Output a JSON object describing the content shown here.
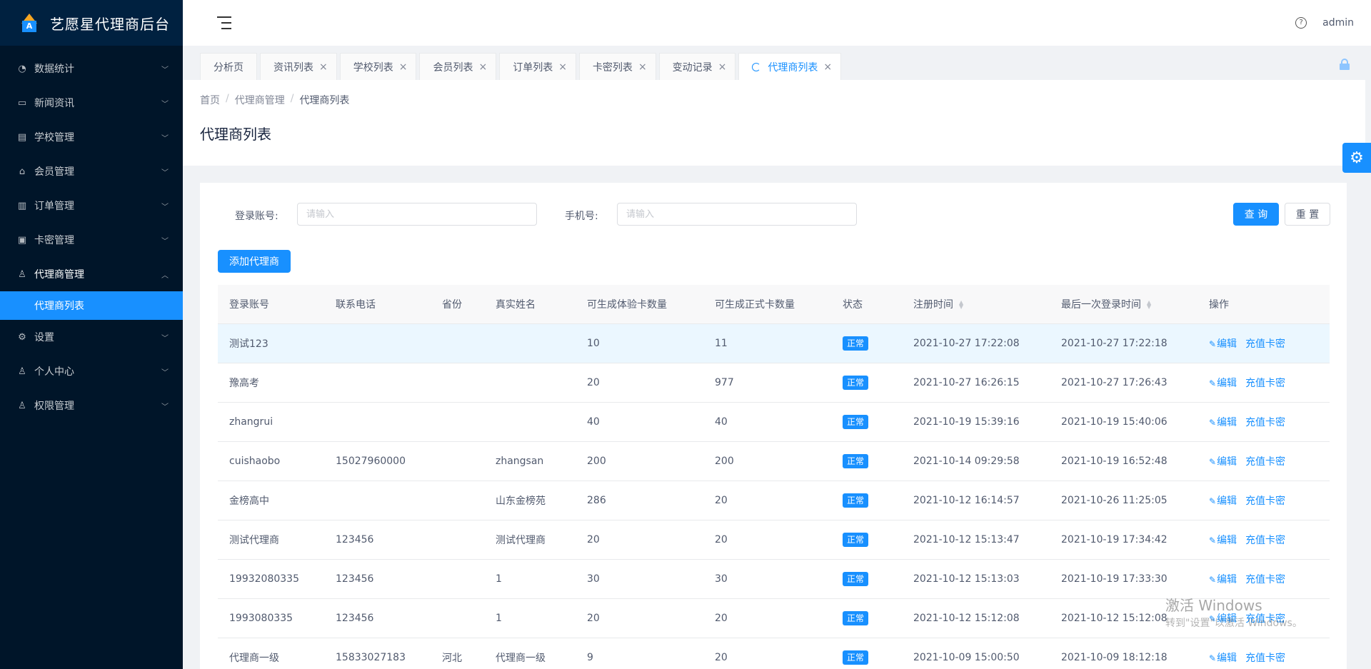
{
  "app": {
    "title": "艺愿星代理商后台",
    "logo_letter": "A"
  },
  "sidebar": {
    "items": [
      {
        "label": "数据统计",
        "icon": "dashboard-icon",
        "glyph": "◔"
      },
      {
        "label": "新闻资讯",
        "icon": "news-icon",
        "glyph": "▭"
      },
      {
        "label": "学校管理",
        "icon": "school-icon",
        "glyph": "▤"
      },
      {
        "label": "会员管理",
        "icon": "member-icon",
        "glyph": "⌂"
      },
      {
        "label": "订单管理",
        "icon": "order-icon",
        "glyph": "▥"
      },
      {
        "label": "卡密管理",
        "icon": "card-icon",
        "glyph": "▣"
      },
      {
        "label": "代理商管理",
        "icon": "agent-icon",
        "glyph": "♙"
      },
      {
        "label": "设置",
        "icon": "settings-icon",
        "glyph": "⚙"
      },
      {
        "label": "个人中心",
        "icon": "user-icon",
        "glyph": "♙"
      },
      {
        "label": "权限管理",
        "icon": "permission-icon",
        "glyph": "♙"
      }
    ],
    "active_sub": "代理商列表"
  },
  "header": {
    "user": "admin",
    "help_glyph": "?"
  },
  "tabs": [
    {
      "label": "分析页",
      "closable": false
    },
    {
      "label": "资讯列表",
      "closable": true
    },
    {
      "label": "学校列表",
      "closable": true
    },
    {
      "label": "会员列表",
      "closable": true
    },
    {
      "label": "订单列表",
      "closable": true
    },
    {
      "label": "卡密列表",
      "closable": true
    },
    {
      "label": "变动记录",
      "closable": true
    },
    {
      "label": "代理商列表",
      "closable": true,
      "active": true
    }
  ],
  "breadcrumb": [
    "首页",
    "代理商管理",
    "代理商列表"
  ],
  "page_title": "代理商列表",
  "search": {
    "account_label": "登录账号:",
    "account_placeholder": "请输入",
    "phone_label": "手机号:",
    "phone_placeholder": "请输入",
    "query_label": "查 询",
    "reset_label": "重 置"
  },
  "add_button": "添加代理商",
  "table": {
    "columns": [
      "登录账号",
      "联系电话",
      "省份",
      "真实姓名",
      "可生成体验卡数量",
      "可生成正式卡数量",
      "状态",
      "注册时间",
      "最后一次登录时间",
      "操作"
    ],
    "edit_label": "编辑",
    "recharge_label": "充值卡密",
    "rows": [
      {
        "account": "测试123",
        "phone": "",
        "province": "",
        "name": "",
        "trial": "10",
        "formal": "11",
        "status": "正常",
        "reg": "2021-10-27 17:22:08",
        "last": "2021-10-27 17:22:18"
      },
      {
        "account": "豫高考",
        "phone": "",
        "province": "",
        "name": "",
        "trial": "20",
        "formal": "977",
        "status": "正常",
        "reg": "2021-10-27 16:26:15",
        "last": "2021-10-27 17:26:43"
      },
      {
        "account": "zhangrui",
        "phone": "",
        "province": "",
        "name": "",
        "trial": "40",
        "formal": "40",
        "status": "正常",
        "reg": "2021-10-19 15:39:16",
        "last": "2021-10-19 15:40:06"
      },
      {
        "account": "cuishaobo",
        "phone": "15027960000",
        "province": "",
        "name": "zhangsan",
        "trial": "200",
        "formal": "200",
        "status": "正常",
        "reg": "2021-10-14 09:29:58",
        "last": "2021-10-19 16:52:48"
      },
      {
        "account": "金榜高中",
        "phone": "",
        "province": "",
        "name": "山东金榜苑",
        "trial": "286",
        "formal": "20",
        "status": "正常",
        "reg": "2021-10-12 16:14:57",
        "last": "2021-10-26 11:25:05"
      },
      {
        "account": "测试代理商",
        "phone": "123456",
        "province": "",
        "name": "测试代理商",
        "trial": "20",
        "formal": "20",
        "status": "正常",
        "reg": "2021-10-12 15:13:47",
        "last": "2021-10-19 17:34:42"
      },
      {
        "account": "19932080335",
        "phone": "123456",
        "province": "",
        "name": "1",
        "trial": "30",
        "formal": "30",
        "status": "正常",
        "reg": "2021-10-12 15:13:03",
        "last": "2021-10-19 17:33:30"
      },
      {
        "account": "1993080335",
        "phone": "123456",
        "province": "",
        "name": "1",
        "trial": "20",
        "formal": "20",
        "status": "正常",
        "reg": "2021-10-12 15:12:08",
        "last": "2021-10-12 15:12:08"
      },
      {
        "account": "代理商一级",
        "phone": "15833027183",
        "province": "河北",
        "name": "代理商一级",
        "trial": "9",
        "formal": "20",
        "status": "正常",
        "reg": "2021-10-09 15:00:50",
        "last": "2021-10-09 18:12:18"
      }
    ]
  },
  "watermark": {
    "line1": "激活 Windows",
    "line2": "转到\"设置\"以激活 Windows。"
  }
}
